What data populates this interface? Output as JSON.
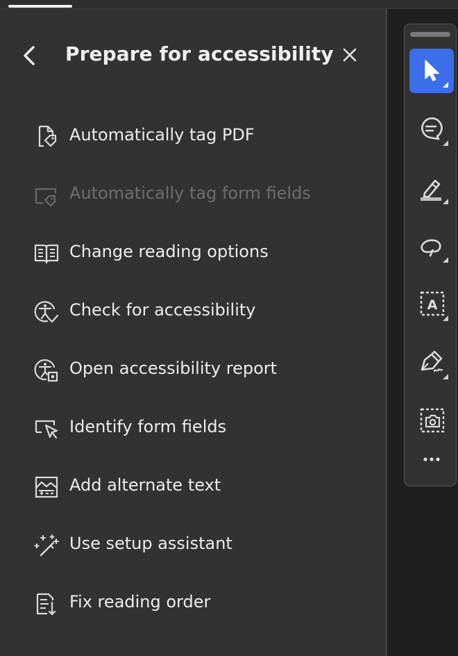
{
  "panel": {
    "title": "Prepare for accessibility",
    "back_icon": "chevron-left-icon",
    "close_icon": "close-icon"
  },
  "menu": [
    {
      "label": "Automatically tag PDF",
      "icon": "document-tag-icon",
      "enabled": true
    },
    {
      "label": "Automatically tag form fields",
      "icon": "form-tag-icon",
      "enabled": false
    },
    {
      "label": "Change reading options",
      "icon": "open-book-icon",
      "enabled": true
    },
    {
      "label": "Check for accessibility",
      "icon": "accessibility-check-icon",
      "enabled": true
    },
    {
      "label": "Open accessibility report",
      "icon": "accessibility-report-icon",
      "enabled": true
    },
    {
      "label": "Identify form fields",
      "icon": "form-field-cursor-icon",
      "enabled": true
    },
    {
      "label": "Add alternate text",
      "icon": "image-alt-text-icon",
      "enabled": true
    },
    {
      "label": "Use setup assistant",
      "icon": "magic-wand-icon",
      "enabled": true
    },
    {
      "label": "Fix reading order",
      "icon": "reading-order-icon",
      "enabled": true
    }
  ],
  "toolbar": {
    "tools": [
      {
        "name": "select-tool",
        "icon": "cursor-arrow-icon",
        "active": true
      },
      {
        "name": "comment-tool",
        "icon": "comment-bubble-icon",
        "active": false
      },
      {
        "name": "highlight-tool",
        "icon": "highlighter-icon",
        "active": false
      },
      {
        "name": "draw-tool",
        "icon": "freehand-loop-icon",
        "active": false
      },
      {
        "name": "text-box-tool",
        "icon": "text-box-icon",
        "active": false
      },
      {
        "name": "sign-tool",
        "icon": "pen-signature-icon",
        "active": false
      },
      {
        "name": "snapshot-tool",
        "icon": "camera-snapshot-icon",
        "active": false
      },
      {
        "name": "more-tools",
        "icon": "more-horizontal-icon",
        "active": false
      }
    ]
  },
  "colors": {
    "accent": "#3b6ee8",
    "panel_bg": "#323232",
    "text": "#ececec",
    "disabled_text": "#6e6e6e"
  }
}
